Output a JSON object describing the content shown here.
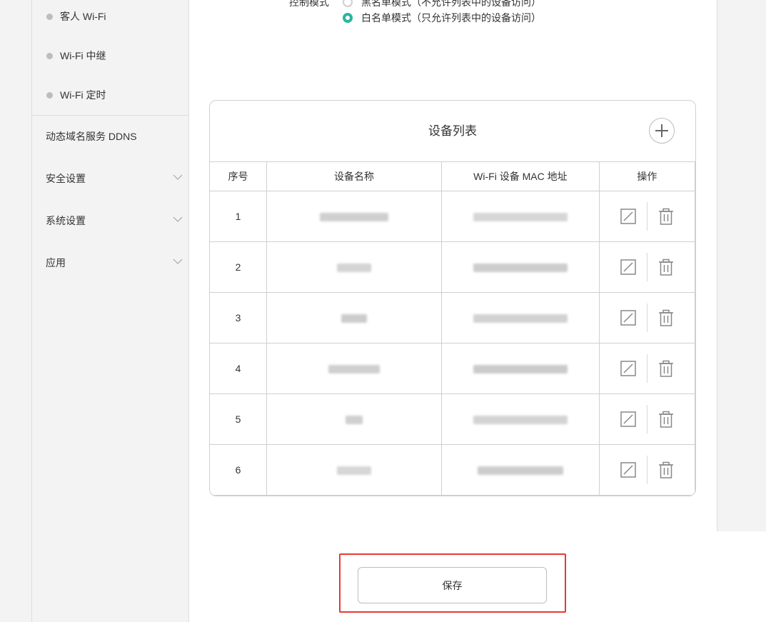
{
  "sidebar": {
    "sub_items": [
      {
        "label": "客人 Wi-Fi"
      },
      {
        "label": "Wi-Fi 中继"
      },
      {
        "label": "Wi-Fi 定时"
      }
    ],
    "menu_items": [
      {
        "label": "动态域名服务 DDNS"
      },
      {
        "label": "安全设置"
      },
      {
        "label": "系统设置"
      },
      {
        "label": "应用"
      }
    ]
  },
  "control_mode": {
    "label": "控制模式",
    "options": [
      {
        "label": "黑名单模式（不允许列表中的设备访问）",
        "selected": false
      },
      {
        "label": "白名单模式（只允许列表中的设备访问）",
        "selected": true
      }
    ]
  },
  "device_list": {
    "title": "设备列表",
    "columns": [
      "序号",
      "设备名称",
      "Wi-Fi 设备 MAC 地址",
      "操作"
    ],
    "rows": [
      {
        "index": "1"
      },
      {
        "index": "2"
      },
      {
        "index": "3"
      },
      {
        "index": "4"
      },
      {
        "index": "5"
      },
      {
        "index": "6"
      }
    ]
  },
  "save_label": "保存",
  "colors": {
    "accent": "#2bb5a0",
    "highlight": "#e53935"
  }
}
